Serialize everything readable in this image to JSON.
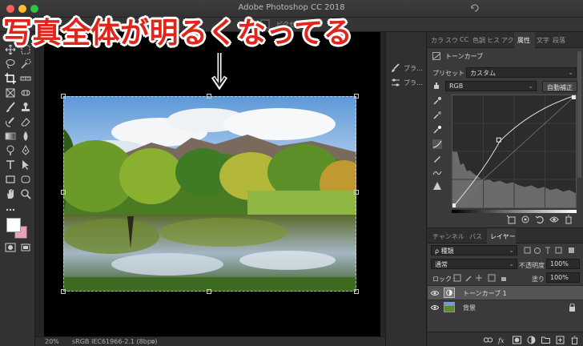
{
  "window": {
    "title": "Adobe Photoshop CC 2018"
  },
  "options_bar": {
    "right_text": "ピクセルを削除"
  },
  "overlay": {
    "caption": "写真全体が明るくなってる"
  },
  "status": {
    "zoom": "20%",
    "profile": "sRGB IEC61966-2.1 (8bpc)",
    "arrow": ">"
  },
  "dock": {
    "items": [
      {
        "label": "ブラ..."
      },
      {
        "label": "ブラ..."
      }
    ]
  },
  "panel_tabs": [
    "カラ",
    "スウ",
    "CC",
    "色調",
    "ヒス",
    "アク",
    "属性",
    "文字",
    "段落"
  ],
  "properties": {
    "title": "トーンカーブ",
    "preset_label": "プリセット :",
    "preset_value": "カスタム",
    "channel": "RGB",
    "auto_button": "自動補正"
  },
  "layers_tabs": [
    "チャンネル",
    "パス",
    "レイヤー"
  ],
  "layers": {
    "kind_filter": "ρ 種類",
    "blend_mode": "通常",
    "opacity_label": "不透明度 :",
    "opacity": "100%",
    "lock_label": "ロック :",
    "fill_label": "塗り :",
    "fill": "100%",
    "items": [
      {
        "name": "トーンカーブ 1",
        "selected": true
      },
      {
        "name": "背景",
        "selected": false
      }
    ]
  },
  "colors": {
    "caption": "#e0251b",
    "bg_swatch": "#e7a2b8",
    "fg_swatch": "#ffffff"
  }
}
